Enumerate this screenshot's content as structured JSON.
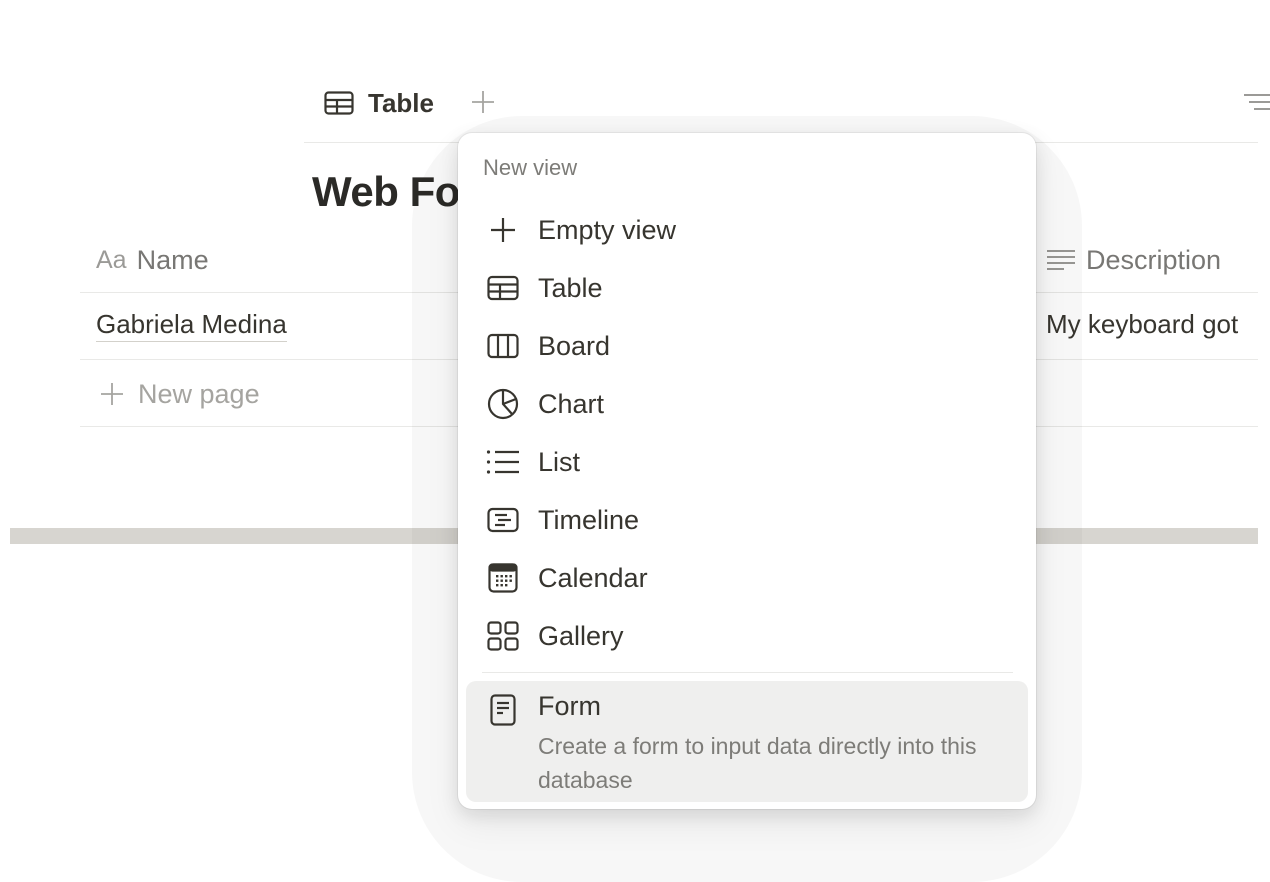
{
  "tabs": {
    "active_label": "Table"
  },
  "database": {
    "title": "Web Fo"
  },
  "table": {
    "name_header": {
      "prefix": "Aa",
      "label": "Name"
    },
    "description_header": "Description",
    "rows": [
      {
        "name": "Gabriela Medina",
        "description": "My keyboard got"
      }
    ],
    "new_page_label": "New page"
  },
  "menu": {
    "header": "New view",
    "items": [
      {
        "label": "Empty view",
        "icon": "plus-icon"
      },
      {
        "label": "Table",
        "icon": "table-icon"
      },
      {
        "label": "Board",
        "icon": "board-icon"
      },
      {
        "label": "Chart",
        "icon": "chart-icon"
      },
      {
        "label": "List",
        "icon": "list-icon"
      },
      {
        "label": "Timeline",
        "icon": "timeline-icon"
      },
      {
        "label": "Calendar",
        "icon": "calendar-icon"
      },
      {
        "label": "Gallery",
        "icon": "gallery-icon"
      }
    ],
    "form": {
      "label": "Form",
      "description": "Create a form to input data directly into this database",
      "icon": "form-icon"
    }
  },
  "colors": {
    "text": "#37352f",
    "muted": "#7d7c78",
    "highlight": "#efefee",
    "divider": "#e9e9e7"
  }
}
